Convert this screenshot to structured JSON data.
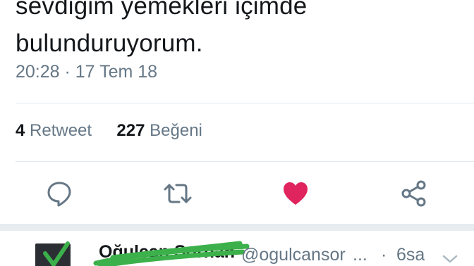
{
  "tweet": {
    "text_lines": [
      "sevdiğim yemekleri içimde",
      "bulunduruyorum."
    ],
    "timestamp": "20:28 · 17 Tem 18"
  },
  "stats": {
    "retweet_count": "4",
    "retweet_label": "Retweet",
    "like_count": "227",
    "like_label": "Beğeni"
  },
  "actions": [
    {
      "icon": "reply-icon",
      "color": "#657786"
    },
    {
      "icon": "retweet-icon",
      "color": "#657786"
    },
    {
      "icon": "heart-icon",
      "color": "#e0245e"
    },
    {
      "icon": "share-icon",
      "color": "#657786"
    }
  ],
  "next_tweet": {
    "display_name": "Oğulcan Sorhan",
    "handle": "@ogulcansor",
    "ellipsis": "...",
    "separator": "·",
    "age": "6sa"
  },
  "colors": {
    "text": "#14171a",
    "secondary": "#657786",
    "divider": "#e1e8ed",
    "like": "#e0245e",
    "scribble": "#3cb04a"
  }
}
